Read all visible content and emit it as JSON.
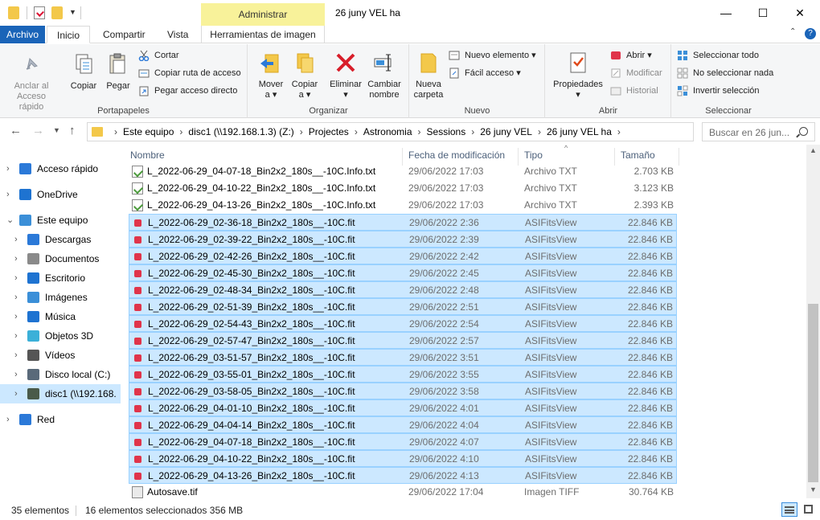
{
  "window": {
    "title": "26 juny VEL ha",
    "context_tab": "Administrar",
    "minimize_glyph": "—",
    "maximize_glyph": "☐",
    "close_glyph": "✕"
  },
  "tabs": {
    "archivo": "Archivo",
    "inicio": "Inicio",
    "compartir": "Compartir",
    "vista": "Vista",
    "herramientas": "Herramientas de imagen"
  },
  "ribbon": {
    "portapapeles": {
      "label": "Portapapeles",
      "anclar": "Anclar al",
      "anclar2": "Acceso rápido",
      "copiar": "Copiar",
      "pegar": "Pegar",
      "cortar": "Cortar",
      "copiar_ruta": "Copiar ruta de acceso",
      "pegar_acceso": "Pegar acceso directo"
    },
    "organizar": {
      "label": "Organizar",
      "mover": "Mover",
      "mover2": "a ▾",
      "copiar": "Copiar",
      "copiar2": "a ▾",
      "eliminar": "Eliminar",
      "eliminar2": "▾",
      "cambiar": "Cambiar",
      "cambiar2": "nombre"
    },
    "nuevo": {
      "label": "Nuevo",
      "nueva": "Nueva",
      "carpeta": "carpeta",
      "nuevo_elemento": "Nuevo elemento ▾",
      "facil_acceso": "Fácil acceso ▾"
    },
    "abrir": {
      "label": "Abrir",
      "propiedades": "Propiedades",
      "propiedades2": "▾",
      "abrir": "Abrir ▾",
      "modificar": "Modificar",
      "historial": "Historial"
    },
    "seleccionar": {
      "label": "Seleccionar",
      "todo": "Seleccionar todo",
      "nada": "No seleccionar nada",
      "invertir": "Invertir selección"
    }
  },
  "address": {
    "crumbs": [
      "Este equipo",
      "disc1 (\\\\192.168.1.3) (Z:)",
      "Projectes",
      "Astronomia",
      "Sessions",
      "26 juny VEL",
      "26 juny VEL ha"
    ],
    "search_placeholder": "Buscar en 26 jun..."
  },
  "nav": [
    {
      "label": "Acceso rápido",
      "icon": "star-icon",
      "color": "#2b79d8"
    },
    {
      "label": "OneDrive",
      "icon": "cloud-icon",
      "color": "#1e73d1"
    },
    {
      "label": "Este equipo",
      "icon": "computer-icon",
      "color": "#3b8fd8"
    },
    {
      "label": "Descargas",
      "icon": "download-arrow-icon",
      "color": "#2b79d8"
    },
    {
      "label": "Documentos",
      "icon": "document-icon",
      "color": "#8a8a8a"
    },
    {
      "label": "Escritorio",
      "icon": "desktop-icon",
      "color": "#1e73d1"
    },
    {
      "label": "Imágenes",
      "icon": "pictures-icon",
      "color": "#3b8fd8"
    },
    {
      "label": "Música",
      "icon": "music-note-icon",
      "color": "#1e73d1"
    },
    {
      "label": "Objetos 3D",
      "icon": "cube-icon",
      "color": "#3bb0d8"
    },
    {
      "label": "Vídeos",
      "icon": "film-icon",
      "color": "#555555"
    },
    {
      "label": "Disco local (C:)",
      "icon": "drive-icon",
      "color": "#5a6a7a"
    },
    {
      "label": "disc1 (\\\\192.168.",
      "icon": "network-drive-icon",
      "color": "#4a5a4a"
    },
    {
      "label": "Red",
      "icon": "network-icon",
      "color": "#2b79d8"
    }
  ],
  "columns": {
    "name": "Nombre",
    "date": "Fecha de modificación",
    "type": "Tipo",
    "size": "Tamaño"
  },
  "files": [
    {
      "name": "L_2022-06-29_04-07-18_Bin2x2_180s__-10C.Info.txt",
      "date": "29/06/2022 17:03",
      "type": "Archivo TXT",
      "size": "2.703 KB",
      "kind": "txt",
      "selected": false
    },
    {
      "name": "L_2022-06-29_04-10-22_Bin2x2_180s__-10C.Info.txt",
      "date": "29/06/2022 17:03",
      "type": "Archivo TXT",
      "size": "3.123 KB",
      "kind": "txt",
      "selected": false
    },
    {
      "name": "L_2022-06-29_04-13-26_Bin2x2_180s__-10C.Info.txt",
      "date": "29/06/2022 17:03",
      "type": "Archivo TXT",
      "size": "2.393 KB",
      "kind": "txt",
      "selected": false
    },
    {
      "name": "L_2022-06-29_02-36-18_Bin2x2_180s__-10C.fit",
      "date": "29/06/2022 2:36",
      "type": "ASIFitsView",
      "size": "22.846 KB",
      "kind": "fit",
      "selected": true
    },
    {
      "name": "L_2022-06-29_02-39-22_Bin2x2_180s__-10C.fit",
      "date": "29/06/2022 2:39",
      "type": "ASIFitsView",
      "size": "22.846 KB",
      "kind": "fit",
      "selected": true
    },
    {
      "name": "L_2022-06-29_02-42-26_Bin2x2_180s__-10C.fit",
      "date": "29/06/2022 2:42",
      "type": "ASIFitsView",
      "size": "22.846 KB",
      "kind": "fit",
      "selected": true
    },
    {
      "name": "L_2022-06-29_02-45-30_Bin2x2_180s__-10C.fit",
      "date": "29/06/2022 2:45",
      "type": "ASIFitsView",
      "size": "22.846 KB",
      "kind": "fit",
      "selected": true
    },
    {
      "name": "L_2022-06-29_02-48-34_Bin2x2_180s__-10C.fit",
      "date": "29/06/2022 2:48",
      "type": "ASIFitsView",
      "size": "22.846 KB",
      "kind": "fit",
      "selected": true
    },
    {
      "name": "L_2022-06-29_02-51-39_Bin2x2_180s__-10C.fit",
      "date": "29/06/2022 2:51",
      "type": "ASIFitsView",
      "size": "22.846 KB",
      "kind": "fit",
      "selected": true
    },
    {
      "name": "L_2022-06-29_02-54-43_Bin2x2_180s__-10C.fit",
      "date": "29/06/2022 2:54",
      "type": "ASIFitsView",
      "size": "22.846 KB",
      "kind": "fit",
      "selected": true
    },
    {
      "name": "L_2022-06-29_02-57-47_Bin2x2_180s__-10C.fit",
      "date": "29/06/2022 2:57",
      "type": "ASIFitsView",
      "size": "22.846 KB",
      "kind": "fit",
      "selected": true
    },
    {
      "name": "L_2022-06-29_03-51-57_Bin2x2_180s__-10C.fit",
      "date": "29/06/2022 3:51",
      "type": "ASIFitsView",
      "size": "22.846 KB",
      "kind": "fit",
      "selected": true
    },
    {
      "name": "L_2022-06-29_03-55-01_Bin2x2_180s__-10C.fit",
      "date": "29/06/2022 3:55",
      "type": "ASIFitsView",
      "size": "22.846 KB",
      "kind": "fit",
      "selected": true
    },
    {
      "name": "L_2022-06-29_03-58-05_Bin2x2_180s__-10C.fit",
      "date": "29/06/2022 3:58",
      "type": "ASIFitsView",
      "size": "22.846 KB",
      "kind": "fit",
      "selected": true
    },
    {
      "name": "L_2022-06-29_04-01-10_Bin2x2_180s__-10C.fit",
      "date": "29/06/2022 4:01",
      "type": "ASIFitsView",
      "size": "22.846 KB",
      "kind": "fit",
      "selected": true
    },
    {
      "name": "L_2022-06-29_04-04-14_Bin2x2_180s__-10C.fit",
      "date": "29/06/2022 4:04",
      "type": "ASIFitsView",
      "size": "22.846 KB",
      "kind": "fit",
      "selected": true
    },
    {
      "name": "L_2022-06-29_04-07-18_Bin2x2_180s__-10C.fit",
      "date": "29/06/2022 4:07",
      "type": "ASIFitsView",
      "size": "22.846 KB",
      "kind": "fit",
      "selected": true
    },
    {
      "name": "L_2022-06-29_04-10-22_Bin2x2_180s__-10C.fit",
      "date": "29/06/2022 4:10",
      "type": "ASIFitsView",
      "size": "22.846 KB",
      "kind": "fit",
      "selected": true
    },
    {
      "name": "L_2022-06-29_04-13-26_Bin2x2_180s__-10C.fit",
      "date": "29/06/2022 4:13",
      "type": "ASIFitsView",
      "size": "22.846 KB",
      "kind": "fit",
      "selected": true
    },
    {
      "name": "Autosave.tif",
      "date": "29/06/2022 17:04",
      "type": "Imagen TIFF",
      "size": "30.764 KB",
      "kind": "tif",
      "selected": false
    }
  ],
  "status": {
    "count": "35 elementos",
    "selection": "16 elementos seleccionados  356 MB"
  },
  "colors": {
    "accent": "#1a64b8",
    "selection": "#cce8ff",
    "selection_border": "#99d1ff",
    "context_tab": "#f8f29a",
    "fit_icon": "#e0344a"
  }
}
